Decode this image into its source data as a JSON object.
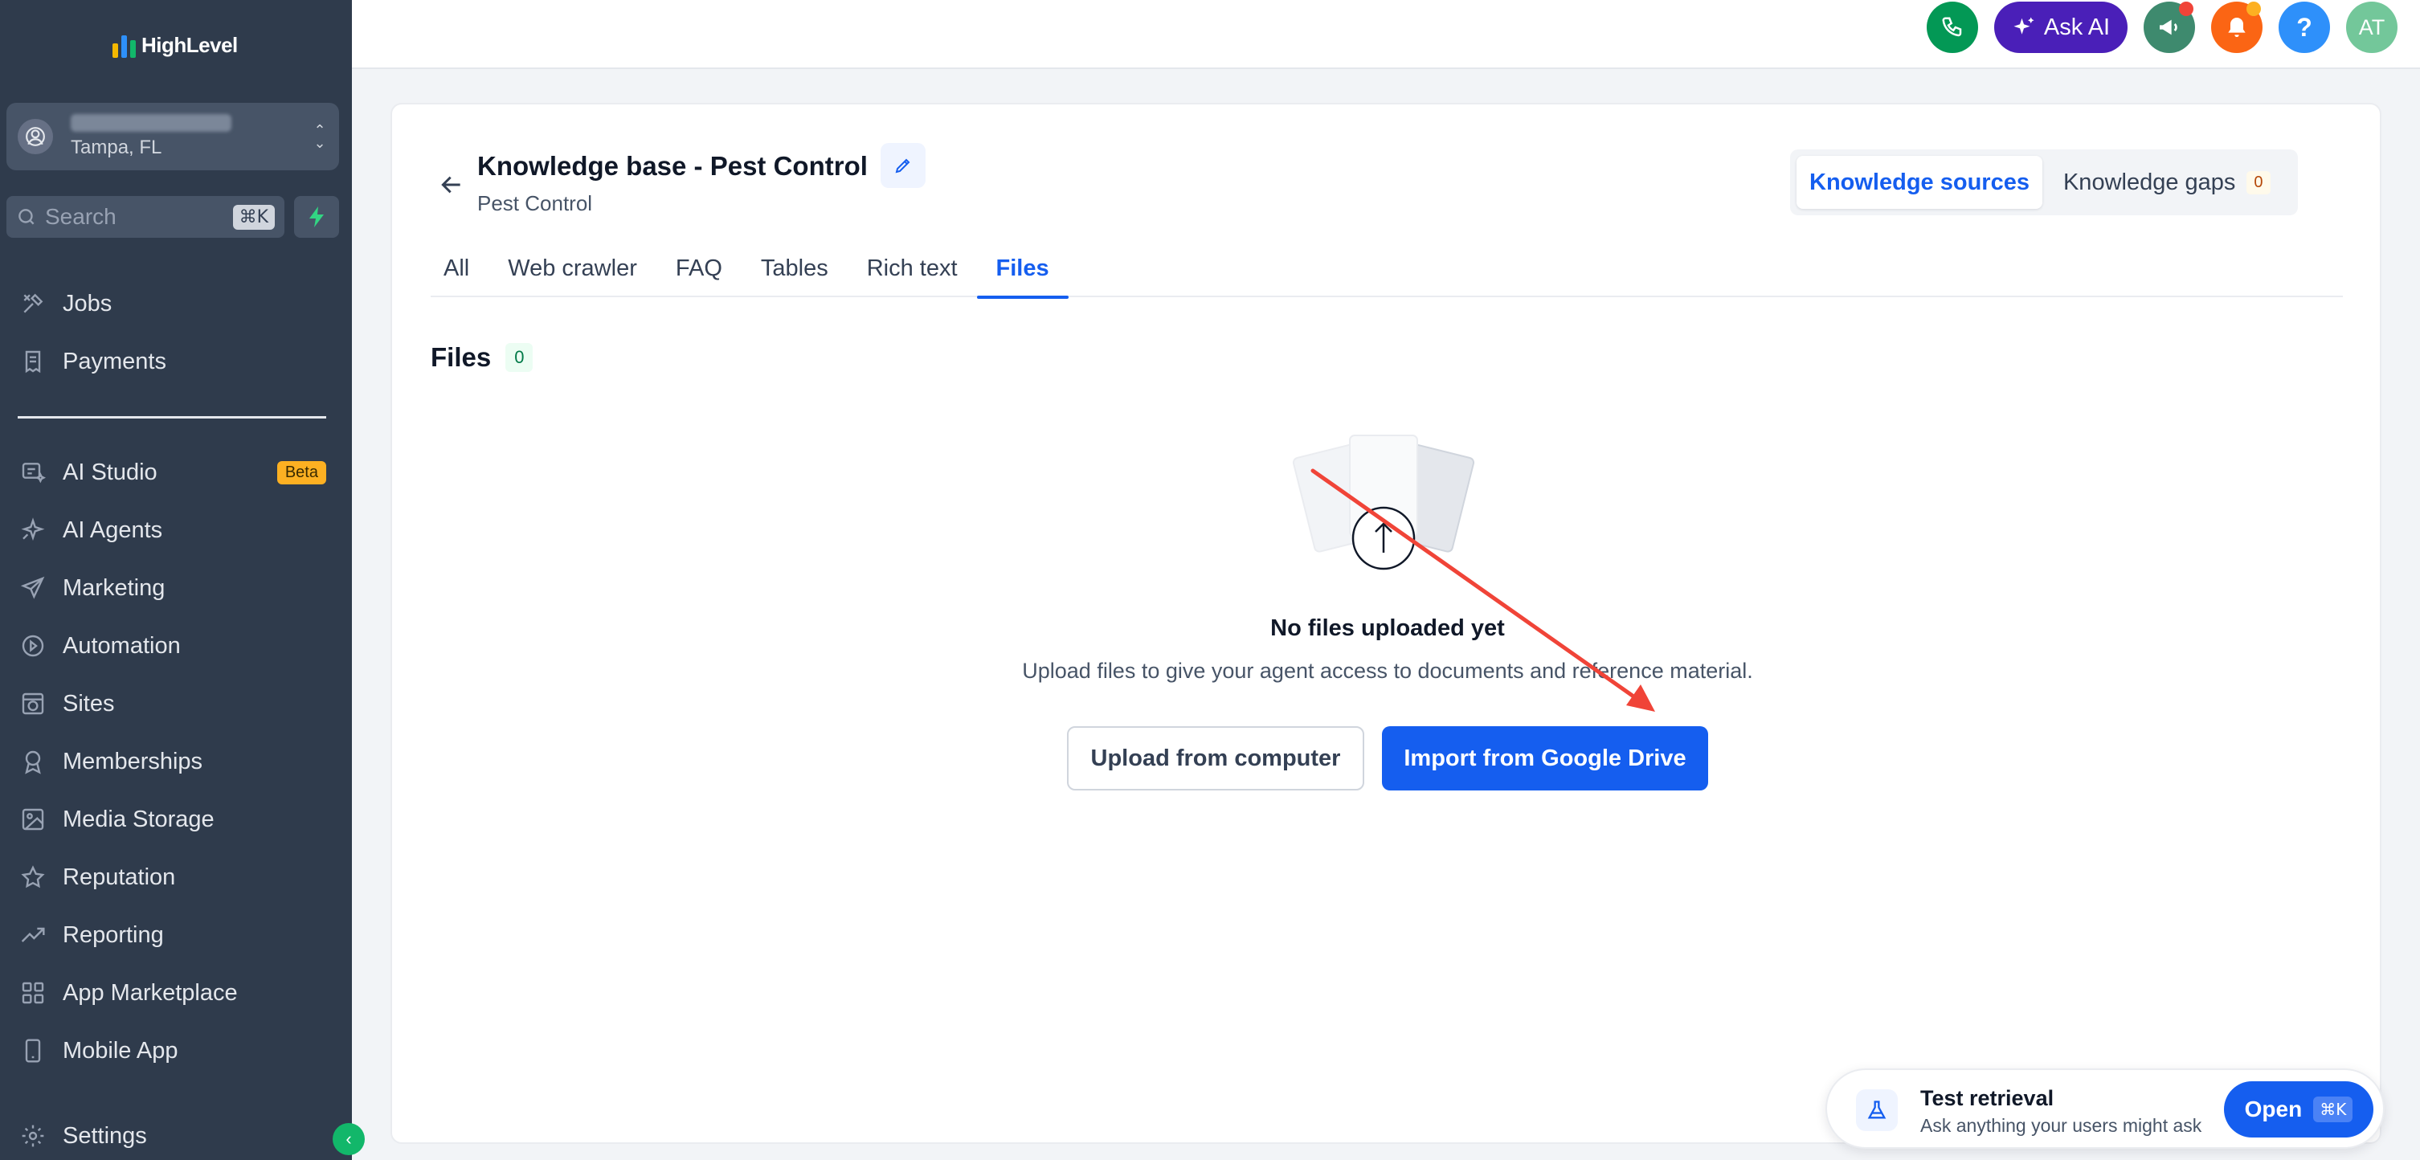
{
  "app": {
    "logo_text": "HighLevel",
    "brand_colors": {
      "sidebar": "#2f3b4c",
      "primary": "#155eef",
      "green": "#12b76a",
      "purple": "#4a1fb8",
      "orange": "#fb6514"
    }
  },
  "sidebar": {
    "account": {
      "location": "Tampa, FL"
    },
    "search": {
      "placeholder": "Search",
      "shortcut": "⌘K"
    },
    "items": [
      {
        "label": "Jobs",
        "icon": "tools-icon"
      },
      {
        "label": "Payments",
        "icon": "receipt-icon"
      },
      {
        "label": "AI Studio",
        "icon": "ai-studio-icon",
        "badge": "Beta"
      },
      {
        "label": "AI Agents",
        "icon": "sparkle-icon"
      },
      {
        "label": "Marketing",
        "icon": "send-icon"
      },
      {
        "label": "Automation",
        "icon": "automation-icon"
      },
      {
        "label": "Sites",
        "icon": "globe-window-icon"
      },
      {
        "label": "Memberships",
        "icon": "award-icon"
      },
      {
        "label": "Media Storage",
        "icon": "image-icon"
      },
      {
        "label": "Reputation",
        "icon": "star-icon"
      },
      {
        "label": "Reporting",
        "icon": "trend-icon"
      },
      {
        "label": "App Marketplace",
        "icon": "grid-icon"
      },
      {
        "label": "Mobile App",
        "icon": "phone-device-icon"
      },
      {
        "label": "Settings",
        "icon": "gear-icon"
      }
    ]
  },
  "topbar": {
    "ask_ai_label": "Ask AI",
    "help_label": "?",
    "avatar_initials": "AT"
  },
  "knowledge_base": {
    "title": "Knowledge base - Pest Control",
    "subtitle": "Pest Control",
    "segments": {
      "sources_label": "Knowledge sources",
      "gaps_label": "Knowledge gaps",
      "gaps_count": "0"
    },
    "tabs": [
      "All",
      "Web crawler",
      "FAQ",
      "Tables",
      "Rich text",
      "Files"
    ],
    "active_tab": "Files"
  },
  "files": {
    "title": "Files",
    "count": "0",
    "empty_title": "No files uploaded yet",
    "empty_desc": "Upload files to give your agent access to documents and reference material.",
    "upload_label": "Upload from computer",
    "import_label": "Import from Google Drive"
  },
  "test_retrieval": {
    "title": "Test retrieval",
    "subtitle": "Ask anything your users might ask",
    "open_label": "Open",
    "open_shortcut": "⌘K"
  }
}
